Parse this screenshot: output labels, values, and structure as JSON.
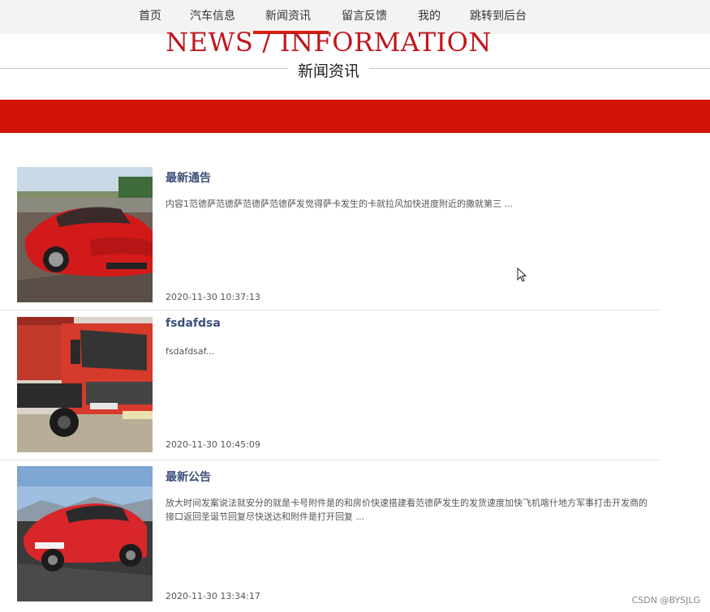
{
  "nav": {
    "items": [
      {
        "label": "首页"
      },
      {
        "label": "汽车信息"
      },
      {
        "label": "新闻资讯"
      },
      {
        "label": "留言反馈"
      },
      {
        "label": "我的"
      },
      {
        "label": "跳转到后台"
      }
    ],
    "active_index": 2,
    "accent_color": "#d81e06"
  },
  "hero": {
    "title_en": "NEWS / INFORMATION",
    "title_cn": "新闻资讯",
    "band_color": "#d21408"
  },
  "news": [
    {
      "title": "最新通告",
      "desc": "内容1范德萨范德萨范德萨范德萨发觉得萨卡发生的卡就拉风加快进度附近的撒就第三 ...",
      "date": "2020-11-30 10:37:13",
      "image": "red-ferrari-image"
    },
    {
      "title": "fsdafdsa",
      "desc": "fsdafdsaf...",
      "date": "2020-11-30 10:45:09",
      "image": "red-dump-truck-image"
    },
    {
      "title": "最新公告",
      "desc": "放大时间发案说法就安分的就是卡号附件是的和房价快速搭建看范德萨发生的发货速度加快飞机喀什地方军事打击开发商的接口返回圣诞节回复尽快送达和附件是打开回复 ...",
      "date": "2020-11-30 13:34:17",
      "image": "red-porsche-image"
    }
  ],
  "watermark": "CSDN @BYSJLG"
}
